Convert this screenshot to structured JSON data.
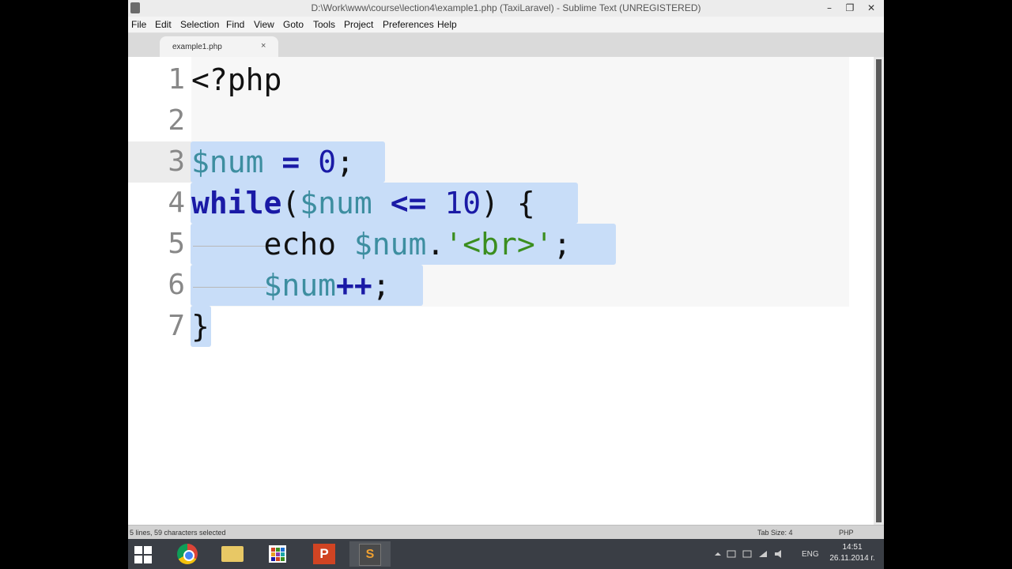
{
  "window": {
    "title": "D:\\Work\\www\\course\\lection4\\example1.php (TaxiLaravel) - Sublime Text (UNREGISTERED)",
    "min_glyph": "–",
    "max_glyph": "❐",
    "close_glyph": "✕"
  },
  "menu": {
    "items": [
      "File",
      "Edit",
      "Selection",
      "Find",
      "View",
      "Goto",
      "Tools",
      "Project",
      "Preferences",
      "Help"
    ]
  },
  "tabs": [
    {
      "label": "example1.php",
      "close": "×",
      "active": true
    }
  ],
  "editor": {
    "line_numbers": [
      "1",
      "2",
      "3",
      "4",
      "5",
      "6",
      "7"
    ],
    "current_line": 3,
    "lines": [
      [
        {
          "t": "<?php",
          "c": "plain"
        }
      ],
      [],
      [
        {
          "t": "$num",
          "c": "var"
        },
        {
          "t": " ",
          "c": "plain"
        },
        {
          "t": "=",
          "c": "op"
        },
        {
          "t": " ",
          "c": "plain"
        },
        {
          "t": "0",
          "c": "num"
        },
        {
          "t": ";",
          "c": "plain"
        }
      ],
      [
        {
          "t": "while",
          "c": "kw"
        },
        {
          "t": "(",
          "c": "plain"
        },
        {
          "t": "$num",
          "c": "var"
        },
        {
          "t": " ",
          "c": "plain"
        },
        {
          "t": "<=",
          "c": "op"
        },
        {
          "t": " ",
          "c": "plain"
        },
        {
          "t": "10",
          "c": "num"
        },
        {
          "t": ") {",
          "c": "plain"
        }
      ],
      [
        {
          "t": "    ",
          "c": "plain"
        },
        {
          "t": "echo",
          "c": "plain"
        },
        {
          "t": " ",
          "c": "plain"
        },
        {
          "t": "$num",
          "c": "var"
        },
        {
          "t": ".",
          "c": "plain"
        },
        {
          "t": "'<br>'",
          "c": "str"
        },
        {
          "t": ";",
          "c": "plain"
        }
      ],
      [
        {
          "t": "    ",
          "c": "plain"
        },
        {
          "t": "$num",
          "c": "var"
        },
        {
          "t": "++",
          "c": "op"
        },
        {
          "t": ";",
          "c": "plain"
        }
      ],
      [
        {
          "t": "}",
          "c": "plain"
        }
      ]
    ]
  },
  "colors": {
    "selection": "#c8ddf8",
    "keyword": "#1a1aa6",
    "variable": "#3d8ea0",
    "string": "#3b8e1f"
  },
  "status": {
    "selection_info": "5 lines, 59 characters selected",
    "tab_size": "Tab Size: 4",
    "syntax": "PHP"
  },
  "taskbar": {
    "apps": [
      "windows-start",
      "chrome",
      "file-explorer",
      "apps",
      "powerpoint",
      "sublime-text"
    ],
    "lang": "ENG",
    "time": "14:51",
    "date": "26.11.2014 г."
  }
}
